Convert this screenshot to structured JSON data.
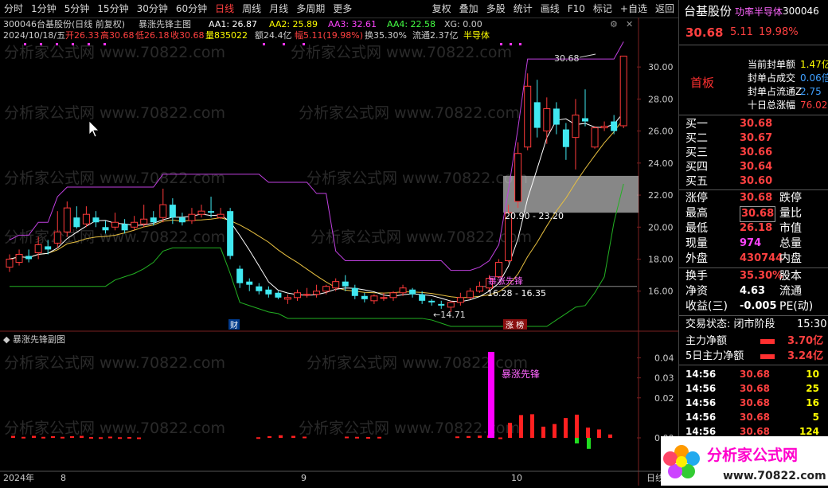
{
  "toolbar": {
    "left": [
      "分时",
      "1分钟",
      "5分钟",
      "15分钟",
      "30分钟",
      "60分钟",
      "日线",
      "周线",
      "月线",
      "多周期",
      "更多"
    ],
    "active": "日线",
    "right": [
      "复权",
      "叠加",
      "多股",
      "统计",
      "画线",
      "F10",
      "标记",
      "+自选",
      "返回"
    ]
  },
  "header": {
    "code": "300046",
    "name": "台基股份(日线 前复权)",
    "indicator": "暴涨先锋主图",
    "aa1": "AA1: 26.87",
    "aa2": "AA2: 25.89",
    "aa3": "AA3: 32.61",
    "aa4": "AA4: 22.58",
    "xg": "XG: 0.00",
    "date": "2024/10/18/五",
    "open": "开26.33",
    "high": "高30.68",
    "low": "低26.18",
    "close": "收30.68",
    "vol": "量835022",
    "amt": "额24.4亿",
    "range": "幅5.11(19.98%)",
    "turn": "换35.30%",
    "float": "流通2.37亿",
    "sector": "半导体"
  },
  "watermark": "分析家公式网 www.70822.com",
  "price_axis": [
    "30.00",
    "28.00",
    "26.00",
    "24.00",
    "22.00",
    "20.00",
    "18.00",
    "16.00"
  ],
  "annotations": {
    "top_price": "30.68",
    "zone_label": "20.90 - 23.20",
    "lower_zone_label": "16.28 - 16.35",
    "low_price": "14.71",
    "signal_text": "暴涨先锋",
    "cai_badge": "财",
    "zt_badge": "涨 榜"
  },
  "sub": {
    "title": "暴涨先锋副图",
    "signal": "暴涨先锋",
    "axis": [
      "0.04",
      "0.03",
      "0.02",
      "0.00"
    ]
  },
  "time_axis": {
    "year": "2024年",
    "m8": "8",
    "m9": "9",
    "m10": "10",
    "tail": "日线"
  },
  "right_panel": {
    "name": "台基股份",
    "tags": "功率半导体",
    "code": "300046",
    "price": "30.68",
    "change": "5.11",
    "pct": "19.98%",
    "status": "首板",
    "seal": [
      {
        "label": "当前封单额",
        "value": "1.47亿"
      },
      {
        "label": "封单占成交",
        "value": "0.06倍"
      },
      {
        "label": "封单占流通Z",
        "value": "2.75"
      },
      {
        "label": "十日总涨幅",
        "value": "76.02"
      }
    ],
    "bids": [
      {
        "label": "买一",
        "price": "30.68"
      },
      {
        "label": "买二",
        "price": "30.67"
      },
      {
        "label": "买三",
        "price": "30.66"
      },
      {
        "label": "买四",
        "price": "30.64"
      },
      {
        "label": "买五",
        "price": "30.60"
      }
    ],
    "stats": [
      {
        "l1": "涨停",
        "v1": "30.68",
        "l2": "跌停",
        "v2": ""
      },
      {
        "l1": "最高",
        "v1": "30.68",
        "l2": "量比",
        "v2": ""
      },
      {
        "l1": "最低",
        "v1": "26.18",
        "l2": "市值",
        "v2": ""
      },
      {
        "l1": "现量",
        "v1": "974",
        "l2": "总量",
        "v2": ""
      },
      {
        "l1": "外盘",
        "v1": "430744",
        "l2": "内盘",
        "v2": ""
      }
    ],
    "stats2": [
      {
        "l1": "换手",
        "v1": "35.30%",
        "l2": "股本"
      },
      {
        "l1": "净资",
        "v1": "4.63",
        "l2": "流通"
      },
      {
        "l1": "收益(三)",
        "v1": "-0.005",
        "l2": "PE(动)"
      }
    ],
    "trade_state": "交易状态: 闭市阶段",
    "trade_time": "15:30",
    "flow": [
      {
        "label": "主力净额",
        "value": "3.70亿"
      },
      {
        "label": "5日主力净额",
        "value": "3.24亿"
      }
    ],
    "ticks": [
      {
        "time": "14:56",
        "price": "30.68",
        "vol": "10"
      },
      {
        "time": "14:56",
        "price": "30.68",
        "vol": "25"
      },
      {
        "time": "14:56",
        "price": "30.68",
        "vol": "16"
      },
      {
        "time": "14:56",
        "price": "30.68",
        "vol": "5"
      },
      {
        "time": "14:56",
        "price": "30.68",
        "vol": "124"
      }
    ],
    "logo_text": "分析家公式网",
    "logo_url": "www.70822.com"
  },
  "chart_data": {
    "type": "candlestick",
    "ylim": [
      13.8,
      31.2
    ],
    "candles": [
      [
        17.5,
        18.0,
        17.2,
        18.3
      ],
      [
        17.8,
        18.3,
        17.6,
        18.6
      ],
      [
        18.2,
        18.0,
        17.8,
        18.6
      ],
      [
        18.4,
        18.9,
        18.0,
        19.4
      ],
      [
        18.8,
        18.6,
        18.3,
        19.2
      ],
      [
        19.0,
        19.7,
        18.7,
        21.0
      ],
      [
        19.7,
        21.2,
        19.4,
        21.6
      ],
      [
        20.6,
        20.0,
        19.9,
        21.3
      ],
      [
        20.2,
        20.8,
        20.0,
        21.3
      ],
      [
        20.6,
        20.3,
        20.0,
        21.0
      ],
      [
        20.0,
        19.8,
        19.6,
        20.4
      ],
      [
        20.0,
        20.3,
        19.8,
        20.9
      ],
      [
        20.2,
        19.8,
        19.6,
        20.5
      ],
      [
        20.0,
        20.3,
        19.8,
        20.7
      ],
      [
        20.2,
        20.5,
        20.0,
        21.4
      ],
      [
        20.6,
        20.3,
        20.1,
        21.0
      ],
      [
        20.6,
        21.4,
        20.3,
        22.4
      ],
      [
        21.4,
        20.6,
        20.2,
        21.8
      ],
      [
        20.6,
        20.3,
        20.1,
        20.9
      ],
      [
        20.4,
        20.8,
        20.2,
        21.2
      ],
      [
        20.8,
        21.0,
        20.6,
        21.4
      ],
      [
        21.0,
        20.9,
        20.6,
        21.9
      ],
      [
        20.6,
        20.8,
        20.5,
        21.2
      ],
      [
        21.0,
        18.2,
        18.0,
        21.2
      ],
      [
        17.4,
        16.5,
        16.2,
        17.6
      ],
      [
        16.6,
        16.4,
        16.0,
        16.8
      ],
      [
        16.3,
        16.0,
        15.8,
        16.5
      ],
      [
        16.1,
        15.8,
        15.6,
        16.3
      ],
      [
        15.9,
        15.6,
        15.5,
        16.0
      ],
      [
        15.5,
        15.6,
        15.2,
        15.8
      ],
      [
        15.6,
        15.9,
        15.4,
        16.1
      ],
      [
        15.8,
        15.8,
        15.6,
        16.2
      ],
      [
        15.8,
        16.0,
        15.6,
        16.4
      ],
      [
        16.0,
        16.3,
        15.8,
        16.4
      ],
      [
        16.2,
        16.6,
        16.0,
        16.8
      ],
      [
        16.6,
        16.3,
        16.0,
        17.0
      ],
      [
        16.2,
        15.7,
        15.5,
        16.4
      ],
      [
        15.7,
        15.5,
        15.3,
        15.9
      ],
      [
        15.4,
        15.7,
        15.2,
        15.8
      ],
      [
        15.6,
        15.6,
        15.4,
        15.9
      ],
      [
        15.6,
        15.9,
        15.4,
        16.0
      ],
      [
        15.9,
        16.2,
        15.7,
        16.4
      ],
      [
        16.1,
        15.8,
        15.6,
        16.2
      ],
      [
        15.8,
        15.4,
        15.2,
        16.0
      ],
      [
        15.4,
        15.3,
        15.1,
        15.5
      ],
      [
        15.2,
        15.1,
        14.9,
        15.4
      ],
      [
        15.0,
        15.3,
        14.7,
        15.4
      ],
      [
        15.3,
        15.6,
        15.1,
        15.9
      ],
      [
        15.6,
        16.0,
        15.5,
        16.2
      ],
      [
        16.0,
        16.3,
        15.9,
        16.6
      ],
      [
        16.2,
        16.8,
        16.0,
        17.0
      ],
      [
        16.9,
        17.8,
        16.8,
        18.0
      ],
      [
        17.9,
        20.9,
        17.8,
        21.4
      ],
      [
        21.6,
        24.6,
        21.2,
        25.3
      ],
      [
        25.0,
        28.8,
        24.8,
        29.6
      ],
      [
        27.8,
        26.2,
        25.6,
        29.2
      ],
      [
        26.0,
        27.4,
        25.2,
        28.1
      ],
      [
        27.4,
        26.4,
        25.8,
        27.8
      ],
      [
        26.1,
        25.0,
        24.2,
        26.5
      ],
      [
        25.6,
        27.0,
        23.6,
        28.0
      ],
      [
        26.8,
        26.6,
        26.3,
        28.6
      ],
      [
        25.0,
        26.2,
        24.9,
        26.3
      ],
      [
        26.2,
        26.3,
        26.0,
        26.6
      ],
      [
        26.6,
        26.0,
        25.8,
        27.0
      ],
      [
        26.33,
        30.68,
        26.18,
        30.68
      ]
    ],
    "sub_values": [
      0.001,
      0.0005,
      0.001,
      0.0005,
      0.0008,
      0.0005,
      0.0008,
      0.001,
      0.0004,
      0.0003,
      0.0006,
      0.0003,
      0.0004,
      0.0002,
      0,
      0,
      0,
      0,
      0,
      0,
      0,
      0,
      0,
      0,
      0.0003,
      0.0008,
      0.0013,
      0.001,
      0.0006,
      0,
      0,
      0,
      0,
      0.0006,
      0.0005,
      0.0004,
      0.0005,
      0,
      0,
      0,
      0.0007,
      0.0009,
      0.0011,
      0.0012,
      0.043,
      0.0002,
      0.0075,
      0.0114,
      0.0118,
      0.0056,
      0.0069,
      0.0098,
      0.0099,
      0.0116,
      0.0051,
      0.0042,
      0.0017,
      -0.0028,
      -0.0055,
      0.0014
    ]
  }
}
